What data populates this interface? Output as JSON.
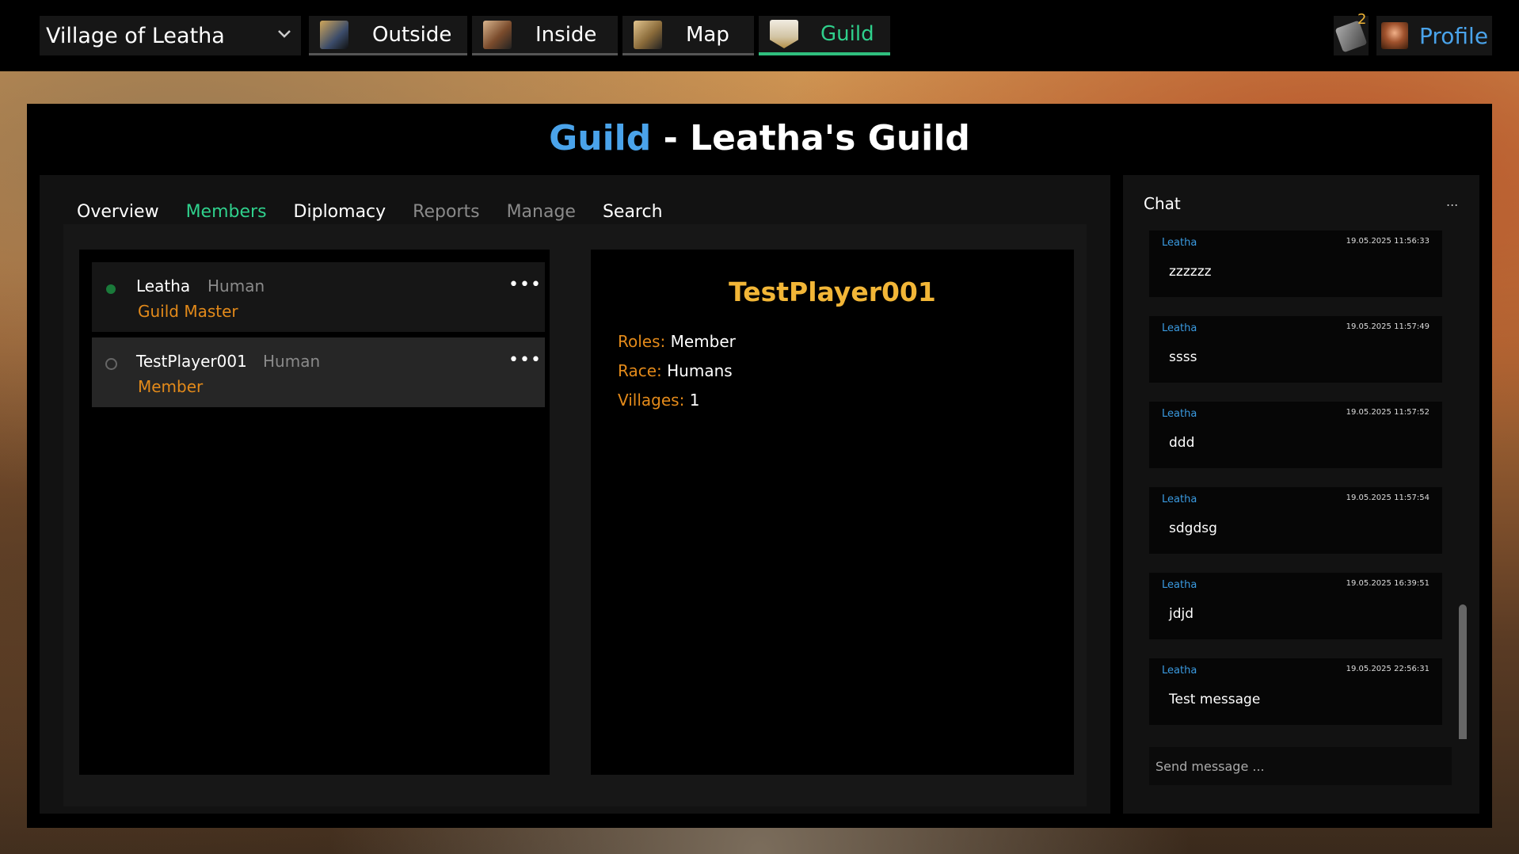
{
  "topbar": {
    "village": "Village of Leatha",
    "tabs": [
      {
        "label": "Outside",
        "icon": "outside-icon"
      },
      {
        "label": "Inside",
        "icon": "inside-icon"
      },
      {
        "label": "Map",
        "icon": "map-icon"
      },
      {
        "label": "Guild",
        "icon": "guild-icon"
      }
    ],
    "active_tab": "Guild",
    "notifications_count": "2",
    "profile_label": "Profile"
  },
  "colors": {
    "accent_green": "#2fd08c",
    "accent_blue": "#4aa3ea",
    "orange": "#e38a1a",
    "gold": "#f2b637"
  },
  "page": {
    "title_prefix": "Guild",
    "title_rest": " - Leatha's Guild"
  },
  "subtabs": [
    {
      "label": "Overview",
      "state": "normal"
    },
    {
      "label": "Members",
      "state": "active"
    },
    {
      "label": "Diplomacy",
      "state": "normal"
    },
    {
      "label": "Reports",
      "state": "disabled"
    },
    {
      "label": "Manage",
      "state": "disabled"
    },
    {
      "label": "Search",
      "state": "normal"
    }
  ],
  "members": [
    {
      "name": "Leatha",
      "race": "Human",
      "role": "Guild Master",
      "online": true,
      "selected": false
    },
    {
      "name": "TestPlayer001",
      "race": "Human",
      "role": "Member",
      "online": false,
      "selected": true
    }
  ],
  "detail": {
    "name": "TestPlayer001",
    "roles_label": "Roles:",
    "roles_value": "Member",
    "race_label": "Race:",
    "race_value": "Humans",
    "villages_label": "Villages:",
    "villages_value": "1"
  },
  "chat": {
    "title": "Chat",
    "more": "...",
    "messages": [
      {
        "author": "Leatha",
        "time": "19.05.2025 11:56:33",
        "text": "zzzzzz"
      },
      {
        "author": "Leatha",
        "time": "19.05.2025 11:57:49",
        "text": "ssss"
      },
      {
        "author": "Leatha",
        "time": "19.05.2025 11:57:52",
        "text": "ddd"
      },
      {
        "author": "Leatha",
        "time": "19.05.2025 11:57:54",
        "text": "sdgdsg"
      },
      {
        "author": "Leatha",
        "time": "19.05.2025 16:39:51",
        "text": "jdjd"
      },
      {
        "author": "Leatha",
        "time": "19.05.2025 22:56:31",
        "text": "Test message"
      }
    ],
    "input_placeholder": "Send message ..."
  }
}
